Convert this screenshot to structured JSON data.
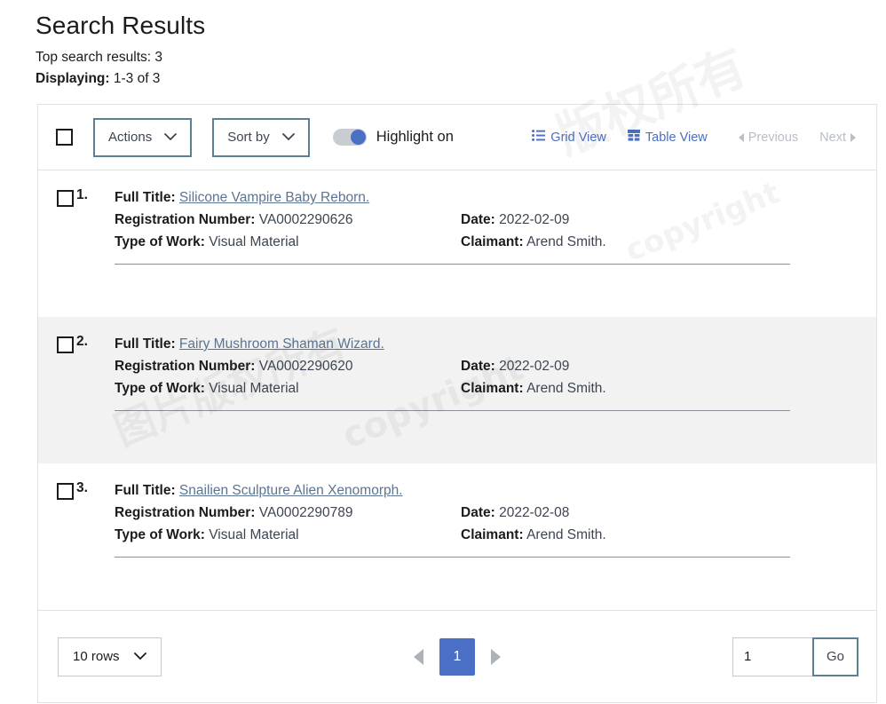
{
  "header": {
    "title": "Search Results",
    "top_results_label": "Top search results:",
    "top_results_count": "3",
    "displaying_label": "Displaying:",
    "displaying_range": "1-3 of 3"
  },
  "toolbar": {
    "select_all_checkbox": "",
    "actions_label": "Actions",
    "sort_by_label": "Sort by",
    "highlight_label": "Highlight on",
    "highlight_state": "on",
    "grid_view_label": "Grid View",
    "table_view_label": "Table View",
    "previous_label": "Previous",
    "next_label": "Next",
    "accent_color": "#4a6fc4",
    "outline_color": "#5d7f94"
  },
  "labels": {
    "full_title": "Full Title:",
    "registration_number": "Registration Number:",
    "type_of_work": "Type of Work:",
    "date": "Date:",
    "claimant": "Claimant:"
  },
  "results": [
    {
      "index": "1.",
      "full_title": "Silicone Vampire Baby Reborn.",
      "registration_number": "VA0002290626",
      "type_of_work": "Visual Material",
      "date": "2022-02-09",
      "claimant": "Arend Smith."
    },
    {
      "index": "2.",
      "full_title": "Fairy Mushroom Shaman Wizard.",
      "registration_number": "VA0002290620",
      "type_of_work": "Visual Material",
      "date": "2022-02-09",
      "claimant": "Arend Smith."
    },
    {
      "index": "3.",
      "full_title": "Snailien Sculpture Alien Xenomorph.",
      "registration_number": "VA0002290789",
      "type_of_work": "Visual Material",
      "date": "2022-02-08",
      "claimant": "Arend Smith."
    }
  ],
  "footer": {
    "rows_per_page": "10 rows",
    "current_page": "1",
    "goto_value": "1",
    "go_label": "Go"
  },
  "watermark": {
    "line1": "版权所有",
    "line2": "copyright",
    "line3": "图片版权所有"
  }
}
